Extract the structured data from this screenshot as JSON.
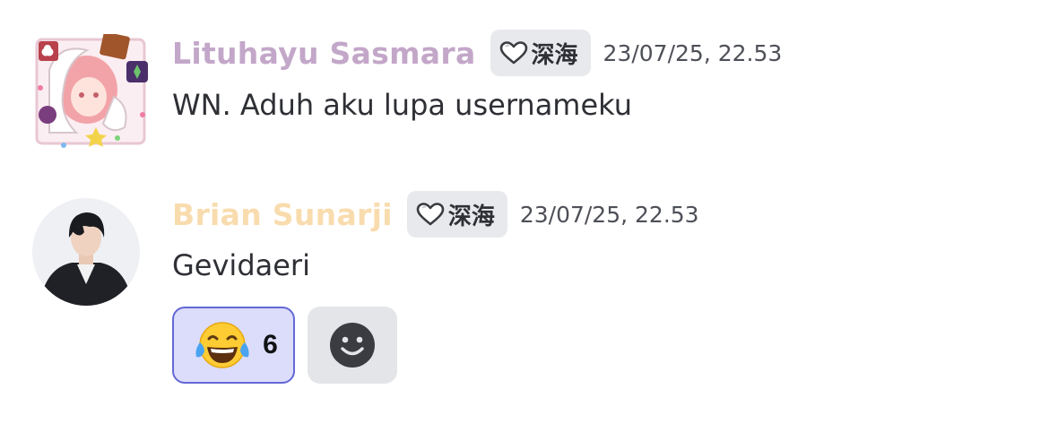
{
  "messages": [
    {
      "username": "Lituhayu Sasmara",
      "username_color": "#c3a7c9",
      "tag": "深海",
      "timestamp": "23/07/25, 22.53",
      "content": "WN. Aduh aku lupa usernameku",
      "avatar": "avatar-anime-girl-with-decorations"
    },
    {
      "username": "Brian Sunarji",
      "username_color": "#f9dcae",
      "tag": "深海",
      "timestamp": "23/07/25, 22.53",
      "content": "Gevidaeri",
      "avatar": "avatar-photo-person-dark-jacket",
      "reactions": [
        {
          "emoji": "face-with-tears-of-joy",
          "count": "6",
          "active": true
        }
      ],
      "add_reaction_icon": "smiley-add-reaction-icon"
    }
  ],
  "colors": {
    "tag_bg": "#e8e9ec",
    "reaction_active_bg": "#dcdcfb",
    "reaction_active_border": "#6469d6",
    "add_reaction_bg": "#e3e5e8"
  }
}
